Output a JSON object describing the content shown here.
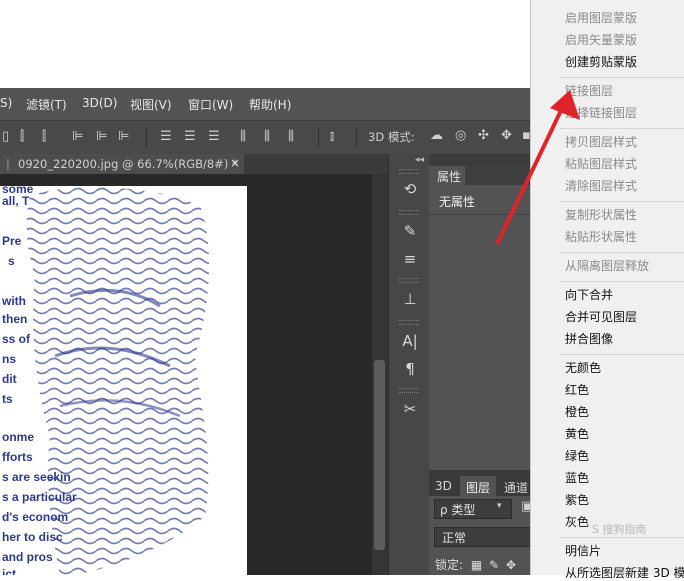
{
  "menubar": {
    "items": [
      {
        "label": "S)"
      },
      {
        "label": "滤镜(T)"
      },
      {
        "label": "3D(D)"
      },
      {
        "label": "视图(V)"
      },
      {
        "label": "窗口(W)"
      },
      {
        "label": "帮助(H)"
      }
    ]
  },
  "options": {
    "mode_label": "3D 模式:",
    "align_icons": [
      "align-top-icon",
      "align-vcenter-icon",
      "align-bottom-icon",
      "align-left-icon",
      "align-hcenter-icon",
      "align-right-icon"
    ],
    "distribute_icons": [
      "distribute-top-icon",
      "distribute-vcenter-icon",
      "distribute-bottom-icon",
      "distribute-left-icon",
      "distribute-hcenter-icon",
      "distribute-right-icon"
    ],
    "mode_icons": [
      "orbit-3d-icon",
      "roll-3d-icon",
      "pan-3d-icon",
      "slide-3d-icon",
      "scale-3d-icon"
    ]
  },
  "document": {
    "tab_title": "0920_220200.jpg @ 66.7%(RGB/8#) *",
    "close_glyph": "×",
    "canvas_text_fragments": [
      "some",
      "all, T",
      "Pre",
      "s",
      "with",
      "then",
      "ss of",
      "ns",
      "dit",
      "ts",
      "onme",
      "fforts",
      "s are seekin",
      "s a particular",
      "d's econom",
      "her to disc",
      "and pros",
      "ict"
    ]
  },
  "tools": {
    "icons": [
      "history-brush-icon",
      "brush-preset-icon",
      "adjustments-icon",
      "clone-source-icon",
      "character-icon",
      "paragraph-icon",
      "tool-presets-icon"
    ],
    "glyphs": [
      "⟲",
      "✎",
      "≡",
      "⊥",
      "A|",
      "¶",
      "✂"
    ]
  },
  "properties": {
    "tab_label": "属性",
    "content": "无属性"
  },
  "layers": {
    "tabs": [
      "3D",
      "图层",
      "通道"
    ],
    "kind_label": "ρ 类型",
    "blend_mode": "正常",
    "lock_label": "锁定:"
  },
  "context_menu": {
    "items": [
      {
        "label": "启用图层蒙版",
        "enabled": false
      },
      {
        "label": "启用矢量蒙版",
        "enabled": false
      },
      {
        "label": "创建剪贴蒙版",
        "enabled": true
      },
      {
        "sep": true
      },
      {
        "label": "链接图层",
        "enabled": false
      },
      {
        "label": "选择链接图层",
        "enabled": false
      },
      {
        "sep": true
      },
      {
        "label": "拷贝图层样式",
        "enabled": false
      },
      {
        "label": "粘贴图层样式",
        "enabled": false
      },
      {
        "label": "清除图层样式",
        "enabled": false
      },
      {
        "sep": true
      },
      {
        "label": "复制形状属性",
        "enabled": false
      },
      {
        "label": "粘贴形状属性",
        "enabled": false
      },
      {
        "sep": true
      },
      {
        "label": "从隔离图层释放",
        "enabled": false
      },
      {
        "sep": true
      },
      {
        "label": "向下合并",
        "enabled": true
      },
      {
        "label": "合并可见图层",
        "enabled": true
      },
      {
        "label": "拼合图像",
        "enabled": true
      },
      {
        "sep": true
      },
      {
        "label": "无颜色",
        "enabled": true
      },
      {
        "label": "红色",
        "enabled": true
      },
      {
        "label": "橙色",
        "enabled": true
      },
      {
        "label": "黄色",
        "enabled": true
      },
      {
        "label": "绿色",
        "enabled": true
      },
      {
        "label": "蓝色",
        "enabled": true
      },
      {
        "label": "紫色",
        "enabled": true
      },
      {
        "label": "灰色",
        "enabled": true
      },
      {
        "sep": true
      },
      {
        "label": "明信片",
        "enabled": true
      },
      {
        "label": "从所选图层新建 3D 模",
        "enabled": true
      }
    ]
  },
  "watermark": "S 搜狗指南",
  "colors": {
    "annotation_arrow": "#e0232a",
    "canvas_ink": "#2d3a8c"
  }
}
